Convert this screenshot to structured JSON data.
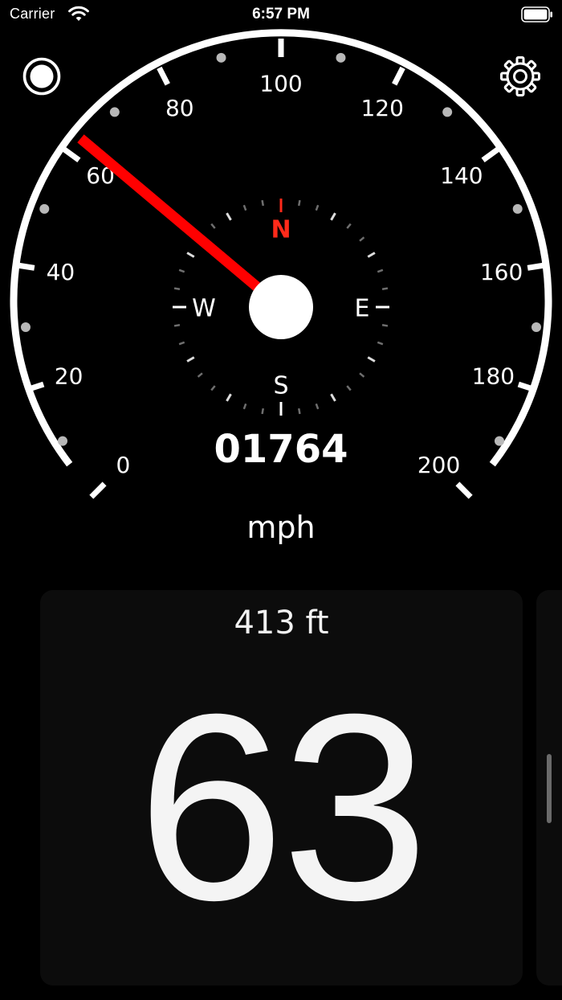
{
  "status_bar": {
    "carrier": "Carrier",
    "time": "6:57 PM",
    "wifi_icon": "wifi-icon",
    "battery_icon": "battery-icon"
  },
  "toolbar": {
    "record_icon": "record-icon",
    "settings_icon": "gear-icon"
  },
  "speedometer": {
    "tick_labels": [
      "0",
      "20",
      "40",
      "60",
      "80",
      "100",
      "120",
      "140",
      "160",
      "180",
      "200"
    ],
    "max_speed": 200,
    "needle_speed": 63,
    "odometer": "01764",
    "unit": "mph",
    "colors": {
      "needle": "#ff0000",
      "dial": "#ffffff",
      "minor_dots": "#b8b8b8"
    }
  },
  "compass": {
    "north": "N",
    "east": "E",
    "south": "S",
    "west": "W",
    "north_color": "#ff2a1a"
  },
  "speed_card": {
    "altitude": "413 ft",
    "speed": "63"
  }
}
